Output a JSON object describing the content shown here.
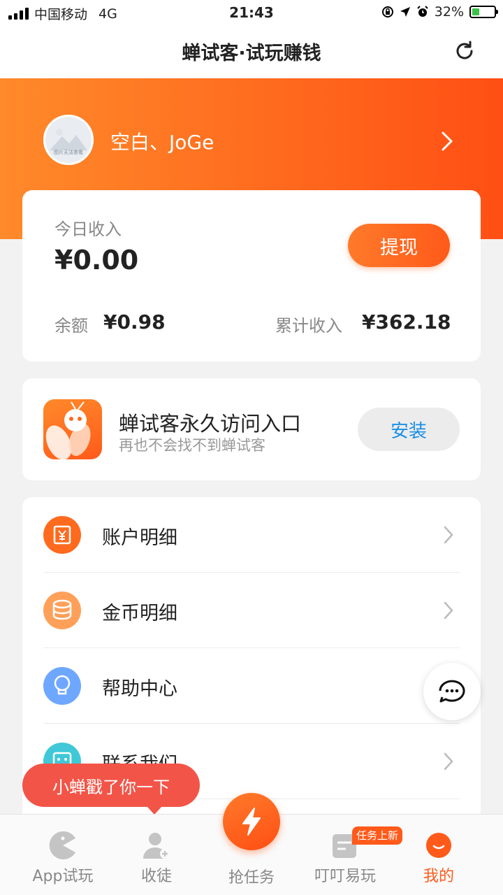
{
  "status_bar": {
    "carrier": "中国移动",
    "network": "4G",
    "time": "21:43",
    "battery": "32%",
    "battery_level": 0.32
  },
  "header": {
    "title": "蝉试客·试玩赚钱"
  },
  "profile": {
    "username": "空白、JoGe",
    "avatar_caption": "图片无法查看"
  },
  "income": {
    "today_label": "今日收入",
    "today_value": "¥0.00",
    "withdraw_label": "提现",
    "balance_label": "余额",
    "balance_value": "¥0.98",
    "total_label": "累计收入",
    "total_value": "¥362.18"
  },
  "install": {
    "title": "蝉试客永久访问入口",
    "subtitle": "再也不会找不到蝉试客",
    "button_label": "安装"
  },
  "menu": {
    "items": [
      {
        "label": "账户明细",
        "icon": "yuan-icon",
        "color": "#ff6a1e"
      },
      {
        "label": "金币明细",
        "icon": "coins-icon",
        "color": "#ffa05a"
      },
      {
        "label": "帮助中心",
        "icon": "lightbulb-icon",
        "color": "#6ea7ff"
      },
      {
        "label": "联系我们",
        "icon": "contact-icon",
        "color": "#40c8d8"
      }
    ]
  },
  "toast": {
    "text": "小蝉戳了你一下"
  },
  "tabbar": {
    "tabs": [
      {
        "label": "App试玩",
        "icon": "pacman-icon"
      },
      {
        "label": "收徒",
        "icon": "add-user-icon"
      },
      {
        "label": "抢任务",
        "icon": "lightning-icon"
      },
      {
        "label": "叮叮易玩",
        "icon": "list-icon",
        "badge": "任务上新"
      },
      {
        "label": "我的",
        "icon": "smile-icon",
        "active": true
      }
    ]
  },
  "colors": {
    "accent": "#ff5a1a",
    "install_blue": "#1a8fe6",
    "toast_red": "#f25548"
  }
}
